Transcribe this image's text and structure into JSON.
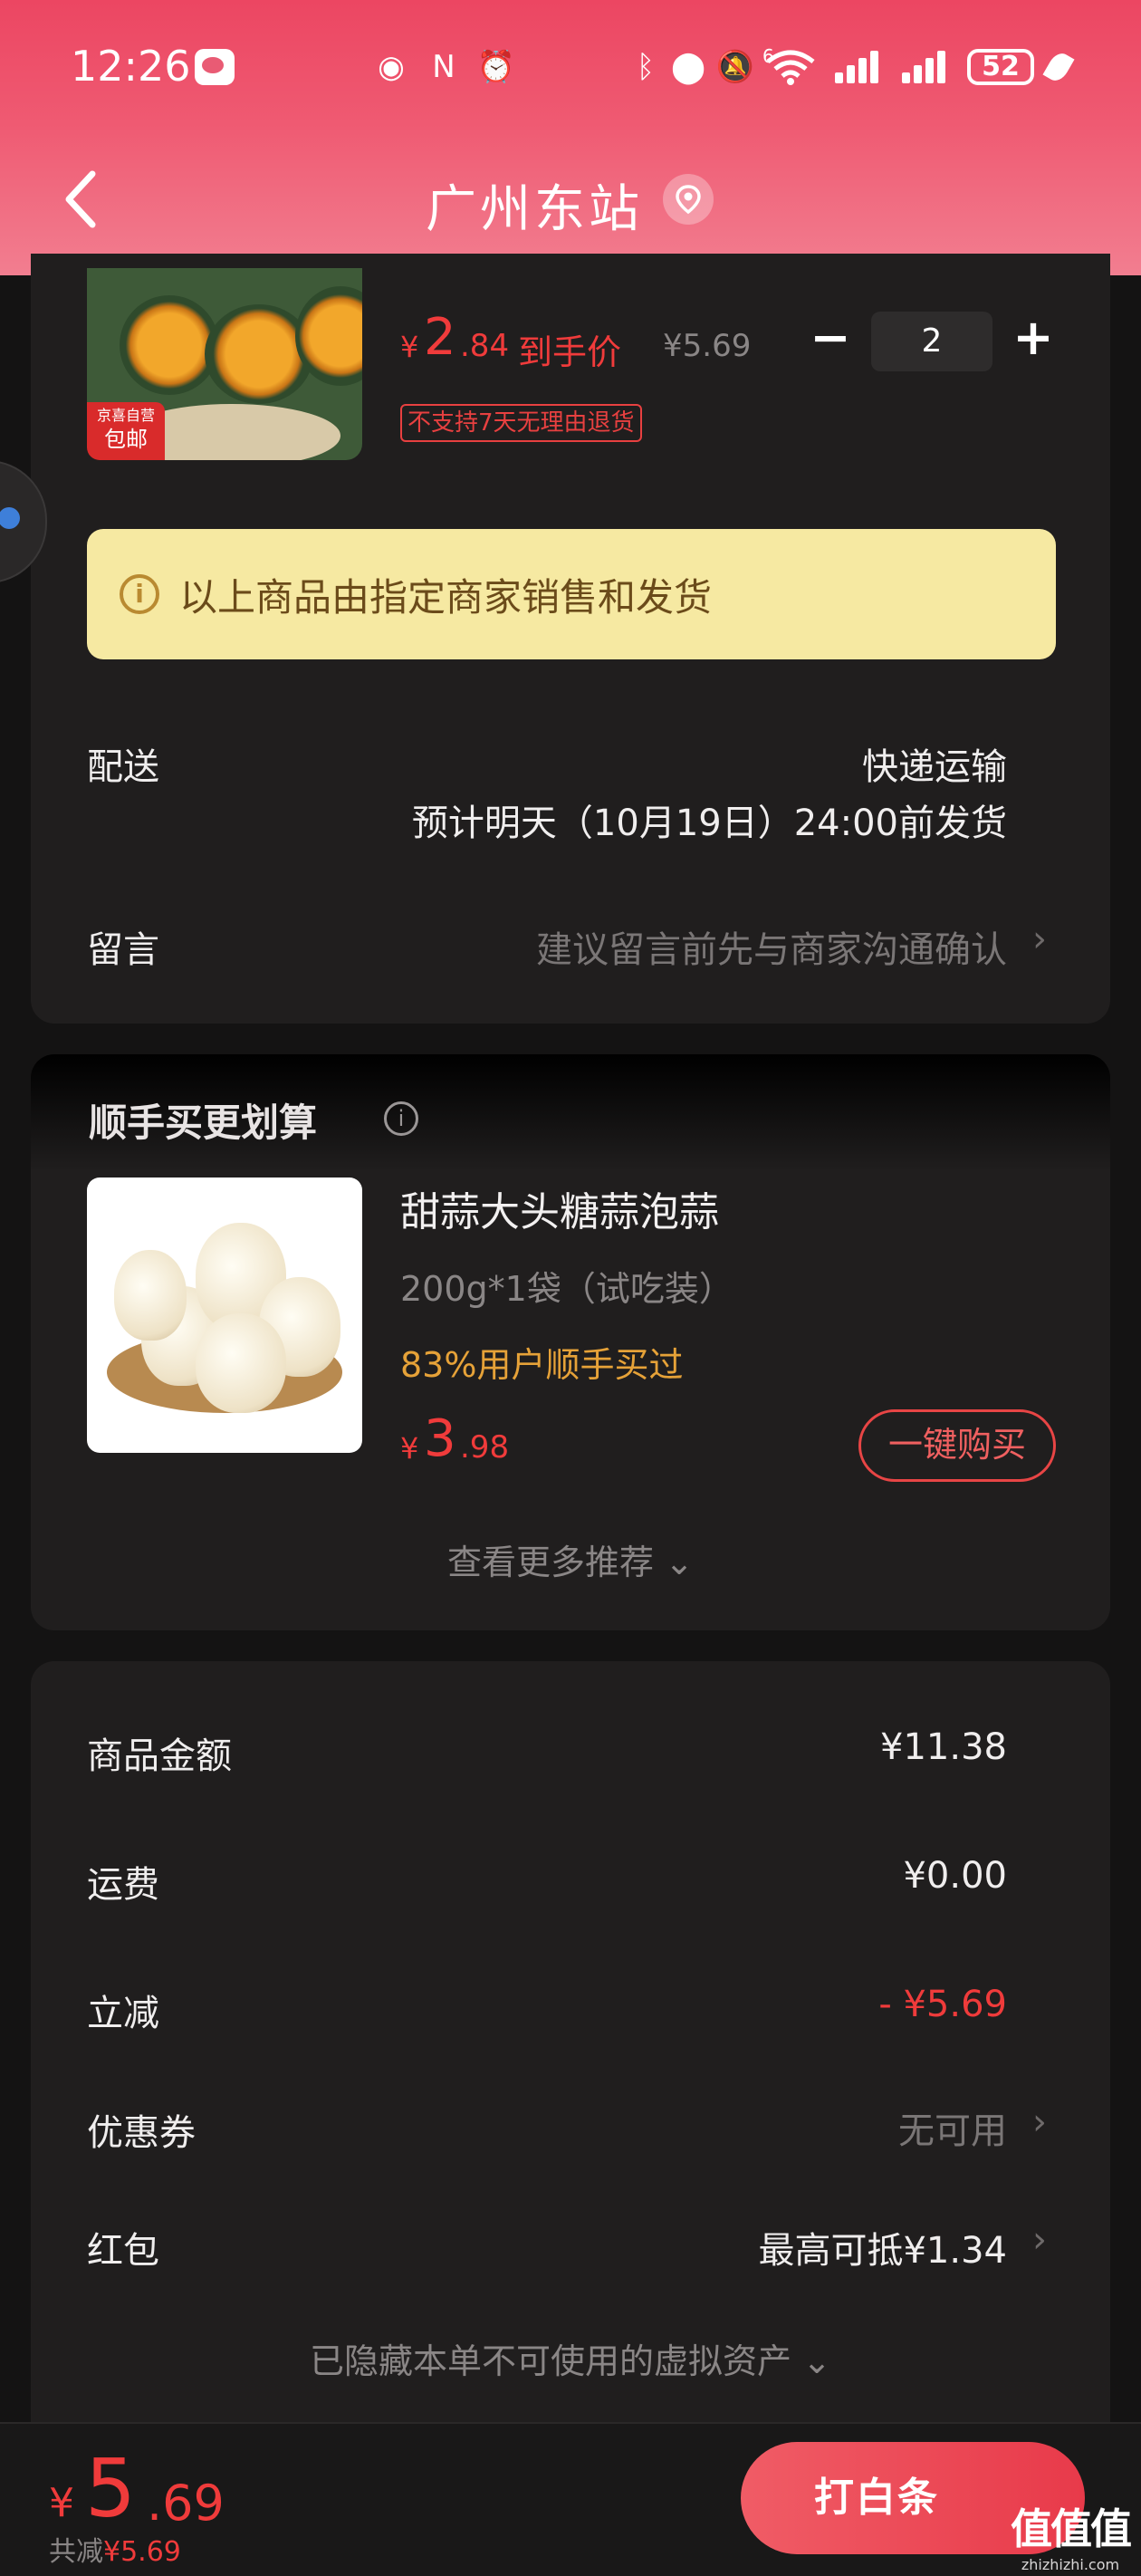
{
  "status_bar": {
    "time": "12:26",
    "battery": "52",
    "network_badge": "6"
  },
  "nav": {
    "title": "广州东站"
  },
  "product": {
    "badge_top": "京喜自营",
    "badge_bottom": "包邮",
    "price_symbol": "¥",
    "price_int": "2",
    "price_dec": ".84",
    "price_label": "到手价",
    "original_price": "¥5.69",
    "quantity": "2",
    "minus_label": "−",
    "plus_label": "+",
    "return_policy": "不支持7天无理由退货"
  },
  "notice": {
    "icon": "i",
    "text": "以上商品由指定商家销售和发货"
  },
  "delivery": {
    "label": "配送",
    "method": "快递运输",
    "estimate": "预计明天（10月19日）24:00前发货"
  },
  "message": {
    "label": "留言",
    "placeholder": "建议留言前先与商家沟通确认"
  },
  "recommend": {
    "section_title": "顺手买更划算",
    "title": "甜蒜大头糖蒜泡蒜",
    "spec": "200g*1袋（试吃装）",
    "stat": "83%用户顺手买过",
    "price_symbol": "¥",
    "price_int": "3",
    "price_dec": ".98",
    "buy_label": "一键购买",
    "more_label": "查看更多推荐 ⌄"
  },
  "summary": {
    "goods_amount_label": "商品金额",
    "goods_amount": "¥11.38",
    "shipping_label": "运费",
    "shipping": "¥0.00",
    "discount_label": "立减",
    "discount": "- ¥5.69",
    "coupon_label": "优惠券",
    "coupon": "无可用",
    "red_packet_label": "红包",
    "red_packet": "最高可抵¥1.34",
    "hidden_assets": "已隐藏本单不可使用的虚拟资产 ⌄"
  },
  "footer": {
    "total_symbol": "¥",
    "total_int": "5",
    "total_dec": ".69",
    "saved_label": "共减",
    "saved_value": "¥5.69",
    "pay_button": "打白条"
  },
  "watermark": {
    "brand": "值值值",
    "url": "zhizhizhi.com"
  },
  "colors": {
    "accent": "#f03b3b",
    "header_pink": "#ec4662",
    "notice_yellow": "#f6e9a2",
    "stat_orange": "#e6a238"
  }
}
